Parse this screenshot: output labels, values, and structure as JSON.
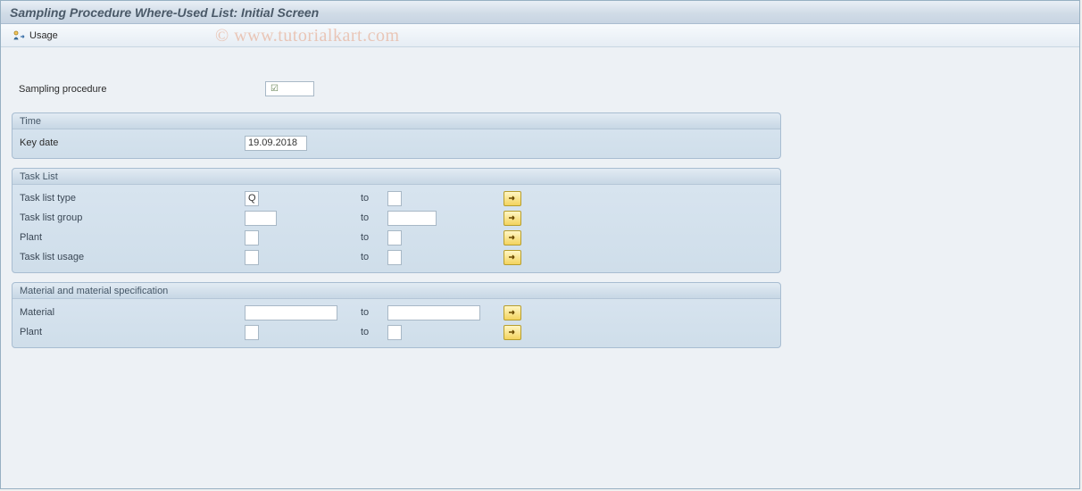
{
  "title": "Sampling Procedure Where-Used List: Initial Screen",
  "watermark": "© www.tutorialkart.com",
  "toolbar": {
    "usage_label": "Usage"
  },
  "top": {
    "sampling_procedure_label": "Sampling procedure",
    "sampling_procedure_value": ""
  },
  "groups": {
    "time": {
      "title": "Time",
      "key_date_label": "Key date",
      "key_date_value": "19.09.2018"
    },
    "task_list": {
      "title": "Task List",
      "to_label": "to",
      "rows": [
        {
          "label": "Task list type",
          "from": "Q",
          "to": "",
          "from_width": "w20",
          "to_width": "w20"
        },
        {
          "label": "Task list group",
          "from": "",
          "to": "",
          "from_width": "w42",
          "to_width": "w56"
        },
        {
          "label": "Plant",
          "from": "",
          "to": "",
          "from_width": "w20",
          "to_width": "w20"
        },
        {
          "label": "Task list usage",
          "from": "",
          "to": "",
          "from_width": "w20",
          "to_width": "w20"
        }
      ]
    },
    "material": {
      "title": "Material and material specification",
      "to_label": "to",
      "rows": [
        {
          "label": "Material",
          "from": "",
          "to": "",
          "from_width": "w100",
          "to_width": "w100"
        },
        {
          "label": "Plant",
          "from": "",
          "to": "",
          "from_width": "w20",
          "to_width": "w20"
        }
      ]
    }
  }
}
